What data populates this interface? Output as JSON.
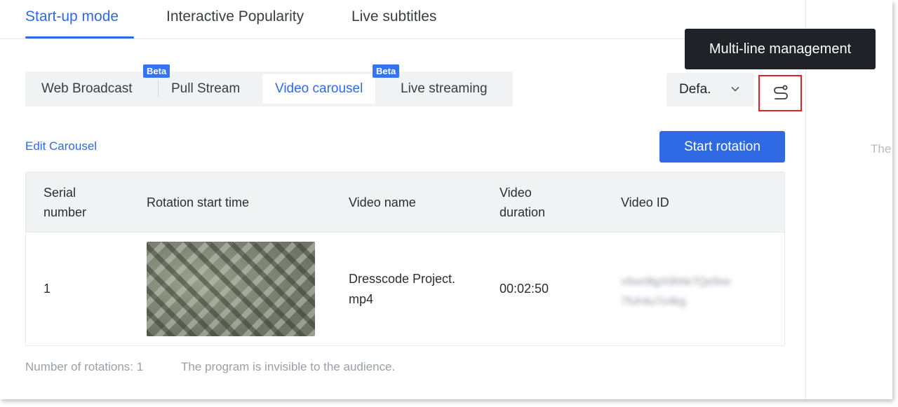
{
  "top_tabs": [
    {
      "label": "Start-up mode",
      "active": true
    },
    {
      "label": "Interactive Popularity",
      "active": false
    },
    {
      "label": "Live subtitles",
      "active": false
    }
  ],
  "mode_switch": {
    "items": [
      {
        "label": "Web Broadcast",
        "active": false
      },
      {
        "label": "Pull Stream",
        "active": false
      },
      {
        "label": "Video carousel",
        "active": true
      },
      {
        "label": "Live streaming",
        "active": false
      }
    ],
    "badges": [
      "Beta",
      "Beta"
    ]
  },
  "line_select": {
    "value": "Defa.",
    "icon": "chevron-down-icon"
  },
  "multi_line": {
    "icon": "route-icon",
    "tooltip": "Multi-line management"
  },
  "actions": {
    "edit_label": "Edit Carousel",
    "start_label": "Start rotation"
  },
  "table": {
    "headers": {
      "serial": [
        "Serial",
        "number"
      ],
      "start_time": "Rotation start time",
      "video_name": "Video name",
      "duration": [
        "Video",
        "duration"
      ],
      "video_id": "Video ID"
    },
    "rows": [
      {
        "serial": "1",
        "video_name": [
          "Dresscode Project.",
          "mp4"
        ],
        "duration": "00:02:50",
        "video_id": [
          "v9xe9lgX0hhk7Qe9xe",
          "7fuh4u7o4kg"
        ]
      }
    ]
  },
  "footer": {
    "rotations": "Number of rotations: 1",
    "visibility": "The program is invisible to the audience."
  },
  "side_panel": {
    "text": "The"
  },
  "colors": {
    "accent": "#2f6ae4",
    "highlight_border": "#e5202a",
    "tooltip_bg": "#1f2328"
  }
}
